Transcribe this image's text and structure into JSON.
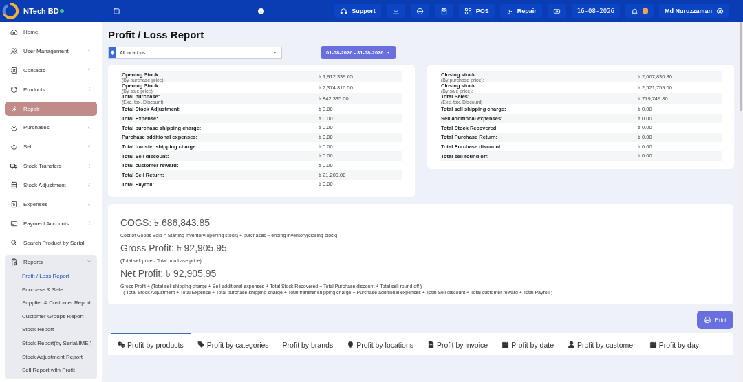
{
  "topbar": {
    "brand": "NTech BD",
    "online": true,
    "buttons": [
      {
        "kind": "text",
        "label": "Support"
      },
      {
        "kind": "icon"
      },
      {
        "kind": "icon"
      },
      {
        "kind": "icon"
      },
      {
        "kind": "text",
        "label": "POS"
      },
      {
        "kind": "text",
        "label": "Repair"
      },
      {
        "kind": "icon"
      },
      {
        "kind": "date",
        "label": "16-08-2026"
      },
      {
        "kind": "bell"
      },
      {
        "kind": "user",
        "label": "Md Nuruzzaman"
      }
    ]
  },
  "sidebar": {
    "items": [
      {
        "label": "Home",
        "kind": "link",
        "selected": false
      },
      {
        "label": "User Management",
        "kind": "menu",
        "selected": false,
        "expanded": false
      },
      {
        "label": "Contacts",
        "kind": "menu",
        "selected": false,
        "expanded": false
      },
      {
        "label": "Products",
        "kind": "menu",
        "selected": false,
        "expanded": false
      },
      {
        "label": "Repair",
        "kind": "link",
        "selected": true
      },
      {
        "label": "Purchases",
        "kind": "menu",
        "selected": false,
        "expanded": false
      },
      {
        "label": "Sell",
        "kind": "menu",
        "selected": false,
        "expanded": false
      },
      {
        "label": "Stock Transfers",
        "kind": "menu",
        "selected": false,
        "expanded": false
      },
      {
        "label": "Stock Adjustment",
        "kind": "menu",
        "selected": false,
        "expanded": false
      },
      {
        "label": "Expenses",
        "kind": "menu",
        "selected": false,
        "expanded": false
      },
      {
        "label": "Payment Accounts",
        "kind": "menu",
        "selected": false,
        "expanded": false
      },
      {
        "label": "Search Product by Serial",
        "kind": "link",
        "selected": false
      },
      {
        "label": "Reports",
        "kind": "menu",
        "selected": false,
        "expanded": true,
        "children": [
          {
            "label": "Profit / Loss Report",
            "selected": true
          },
          {
            "label": "Purchase & Sale",
            "selected": false
          },
          {
            "label": "Supplier & Customer Report",
            "selected": false
          },
          {
            "label": "Customer Groups Report",
            "selected": false
          },
          {
            "label": "Stock Report",
            "selected": false
          },
          {
            "label": "Stock Report(by Serial/IMEI)",
            "selected": false
          },
          {
            "label": "Stock Adjustment Report",
            "selected": false
          },
          {
            "label": "Sell Report with Profit",
            "selected": false
          }
        ]
      }
    ]
  },
  "page_title": "Profit / Loss Report",
  "filters": {
    "location": "All locations",
    "date_range": "01-08-2026 - 31-08-2026"
  },
  "left_card": {
    "rows": [
      {
        "label": "Opening Stock",
        "note": "(By purchase price):",
        "value": "৳ 1,912,339.65"
      },
      {
        "label": "Opening Stock",
        "note": "(By sale price):",
        "value": "৳ 2,374,810.50"
      },
      {
        "label": "Total purchase:",
        "note": "(Exc. tax, Discount)",
        "value": "৳ 842,335.00"
      },
      {
        "label": "Total Stock Adjustment:",
        "value": "৳ 0.00"
      },
      {
        "label": "Total Expense:",
        "value": "৳ 0.00"
      },
      {
        "label": "Total purchase shipping charge:",
        "value": "৳ 0.00"
      },
      {
        "label": "Purchase additional expenses:",
        "value": "৳ 0.00"
      },
      {
        "label": "Total transfer shipping charge:",
        "value": "৳ 0.00"
      },
      {
        "label": "Total Sell discount:",
        "value": "৳ 0.00"
      },
      {
        "label": "Total customer reward:",
        "value": "৳ 0.00"
      },
      {
        "label": "Total Sell Return:",
        "value": "৳ 21,200.00"
      },
      {
        "label": "Total Payroll:",
        "value": "৳ 0.00"
      }
    ]
  },
  "right_card": {
    "rows": [
      {
        "label": "Closing stock",
        "note": "(By purchase price):",
        "value": "৳ 2,067,830.80"
      },
      {
        "label": "Closing stock",
        "note": "(By sale price):",
        "value": "৳ 2,521,759.00"
      },
      {
        "label": "Total Sales:",
        "note": "(Exc. tax, Discount)",
        "value": "৳ 779,749.80"
      },
      {
        "label": "Total sell shipping charge:",
        "value": "৳ 0.00"
      },
      {
        "label": "Sell additional expenses:",
        "value": "৳ 0.00"
      },
      {
        "label": "Total Stock Recovered:",
        "value": "৳ 0.00"
      },
      {
        "label": "Total Purchase Return:",
        "value": "৳ 0.00"
      },
      {
        "label": "Total Purchase discount:",
        "value": "৳ 0.00"
      },
      {
        "label": "Total sell round off:",
        "value": "৳ 0.00"
      }
    ]
  },
  "summary": [
    {
      "heading": "COGS: ৳ 686,843.85",
      "notes": [
        "Cost of Goods Sold = Starting inventory(opening stock) + purchases − ending inventory(closing stock)"
      ]
    },
    {
      "heading": "Gross Profit: ৳ 92,905.95",
      "notes": [
        "(Total sell price - Total purchase price)"
      ]
    },
    {
      "heading": "Net Profit: ৳ 92,905.95",
      "notes": [
        "Gross Profit + (Total sell shipping charge + Sell additional expenses + Total Stock Recovered + Total Purchase discount + Total sell round off )",
        "- ( Total Stock Adjustment + Total Expense + Total purchase shipping charge + Total transfer shipping charge + Purchase additional expenses + Total Sell discount + Total customer reward + Total Payroll )"
      ]
    }
  ],
  "print_button": "Print",
  "tabs": [
    {
      "label": "Profit by products",
      "selected": true
    },
    {
      "label": "Profit by categories",
      "selected": false
    },
    {
      "label": "Profit by brands",
      "selected": false
    },
    {
      "label": "Profit by locations",
      "selected": false
    },
    {
      "label": "Profit by invoice",
      "selected": false
    },
    {
      "label": "Profit by date",
      "selected": false
    },
    {
      "label": "Profit by customer",
      "selected": false
    },
    {
      "label": "Profit by day",
      "selected": false
    }
  ]
}
